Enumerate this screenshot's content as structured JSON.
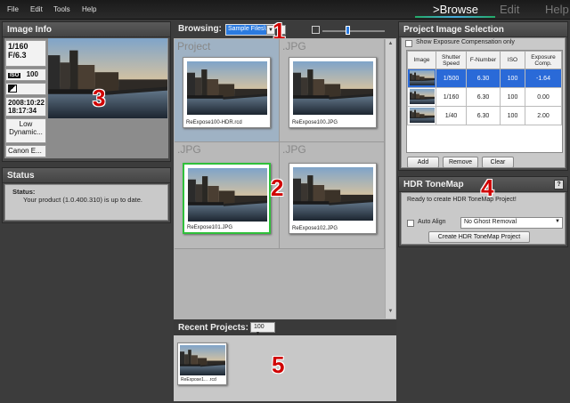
{
  "menu": [
    "File",
    "Edit",
    "Tools",
    "Help"
  ],
  "mode_tabs": {
    "browse": ">Browse",
    "edit": "Edit",
    "help": "Help"
  },
  "image_info": {
    "title": "Image Info",
    "exposure": "1/160",
    "aperture": "F/6.3",
    "iso": "100",
    "date": "2008:10:22",
    "time": "18:17:34",
    "dynamic": "Low Dynamic...",
    "camera": "Canon E..."
  },
  "status": {
    "title": "Status",
    "heading": "Status:",
    "message": "Your product (1.0.400.310) is up to date."
  },
  "browsing": {
    "label": "Browsing:",
    "folder": "Sample Files\\",
    "groups": [
      {
        "name": "Project",
        "file": "ReExpose100-HDR.rcd"
      },
      {
        "name": ".JPG",
        "file": "ReExpose100.JPG"
      },
      {
        "name": ".JPG",
        "file": "ReExpose101.JPG"
      },
      {
        "name": ".JPG",
        "file": "ReExpose102.JPG"
      }
    ]
  },
  "recent": {
    "label": "Recent Projects:",
    "count": "100",
    "item": "ReExpose1... .rcd"
  },
  "project_selection": {
    "title": "Project Image Selection",
    "checkbox": "Show Exposure Compensation only",
    "columns": [
      "Image",
      "Shutter Speed",
      "F-Number",
      "ISO",
      "Exposure Comp."
    ],
    "rows": [
      {
        "shutter": "1/500",
        "fnumber": "6.30",
        "iso": "100",
        "comp": "-1.64"
      },
      {
        "shutter": "1/160",
        "fnumber": "6.30",
        "iso": "100",
        "comp": "0.00"
      },
      {
        "shutter": "1/40",
        "fnumber": "6.30",
        "iso": "100",
        "comp": "2.00"
      }
    ],
    "buttons": {
      "add": "Add",
      "remove": "Remove",
      "clear": "Clear"
    }
  },
  "hdr": {
    "title": "HDR ToneMap",
    "help": "?",
    "ready": "Ready to create HDR ToneMap Project!",
    "auto_align": "Auto Align",
    "ghost": "No Ghost Removal",
    "create": "Create HDR ToneMap Project"
  },
  "callouts": [
    "1",
    "2",
    "3",
    "4",
    "5"
  ]
}
